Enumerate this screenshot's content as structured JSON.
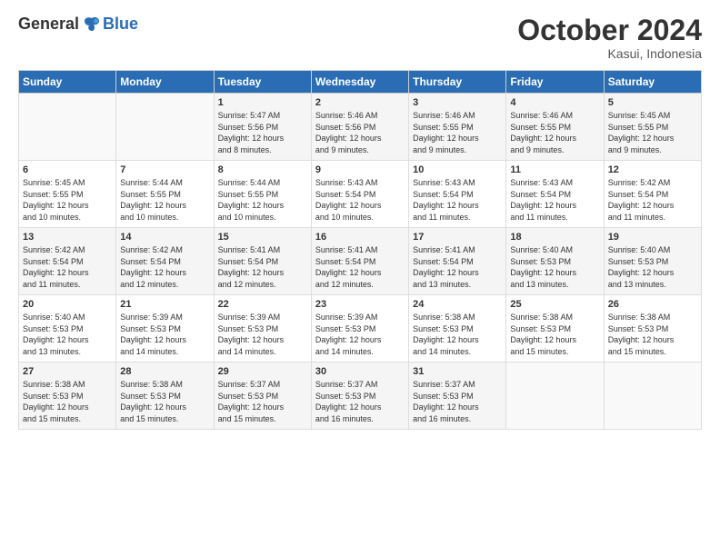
{
  "logo": {
    "general": "General",
    "blue": "Blue"
  },
  "title": "October 2024",
  "location": "Kasui, Indonesia",
  "days_header": [
    "Sunday",
    "Monday",
    "Tuesday",
    "Wednesday",
    "Thursday",
    "Friday",
    "Saturday"
  ],
  "weeks": [
    [
      {
        "day": "",
        "info": ""
      },
      {
        "day": "",
        "info": ""
      },
      {
        "day": "1",
        "info": "Sunrise: 5:47 AM\nSunset: 5:56 PM\nDaylight: 12 hours\nand 8 minutes."
      },
      {
        "day": "2",
        "info": "Sunrise: 5:46 AM\nSunset: 5:56 PM\nDaylight: 12 hours\nand 9 minutes."
      },
      {
        "day": "3",
        "info": "Sunrise: 5:46 AM\nSunset: 5:55 PM\nDaylight: 12 hours\nand 9 minutes."
      },
      {
        "day": "4",
        "info": "Sunrise: 5:46 AM\nSunset: 5:55 PM\nDaylight: 12 hours\nand 9 minutes."
      },
      {
        "day": "5",
        "info": "Sunrise: 5:45 AM\nSunset: 5:55 PM\nDaylight: 12 hours\nand 9 minutes."
      }
    ],
    [
      {
        "day": "6",
        "info": "Sunrise: 5:45 AM\nSunset: 5:55 PM\nDaylight: 12 hours\nand 10 minutes."
      },
      {
        "day": "7",
        "info": "Sunrise: 5:44 AM\nSunset: 5:55 PM\nDaylight: 12 hours\nand 10 minutes."
      },
      {
        "day": "8",
        "info": "Sunrise: 5:44 AM\nSunset: 5:55 PM\nDaylight: 12 hours\nand 10 minutes."
      },
      {
        "day": "9",
        "info": "Sunrise: 5:43 AM\nSunset: 5:54 PM\nDaylight: 12 hours\nand 10 minutes."
      },
      {
        "day": "10",
        "info": "Sunrise: 5:43 AM\nSunset: 5:54 PM\nDaylight: 12 hours\nand 11 minutes."
      },
      {
        "day": "11",
        "info": "Sunrise: 5:43 AM\nSunset: 5:54 PM\nDaylight: 12 hours\nand 11 minutes."
      },
      {
        "day": "12",
        "info": "Sunrise: 5:42 AM\nSunset: 5:54 PM\nDaylight: 12 hours\nand 11 minutes."
      }
    ],
    [
      {
        "day": "13",
        "info": "Sunrise: 5:42 AM\nSunset: 5:54 PM\nDaylight: 12 hours\nand 11 minutes."
      },
      {
        "day": "14",
        "info": "Sunrise: 5:42 AM\nSunset: 5:54 PM\nDaylight: 12 hours\nand 12 minutes."
      },
      {
        "day": "15",
        "info": "Sunrise: 5:41 AM\nSunset: 5:54 PM\nDaylight: 12 hours\nand 12 minutes."
      },
      {
        "day": "16",
        "info": "Sunrise: 5:41 AM\nSunset: 5:54 PM\nDaylight: 12 hours\nand 12 minutes."
      },
      {
        "day": "17",
        "info": "Sunrise: 5:41 AM\nSunset: 5:54 PM\nDaylight: 12 hours\nand 13 minutes."
      },
      {
        "day": "18",
        "info": "Sunrise: 5:40 AM\nSunset: 5:53 PM\nDaylight: 12 hours\nand 13 minutes."
      },
      {
        "day": "19",
        "info": "Sunrise: 5:40 AM\nSunset: 5:53 PM\nDaylight: 12 hours\nand 13 minutes."
      }
    ],
    [
      {
        "day": "20",
        "info": "Sunrise: 5:40 AM\nSunset: 5:53 PM\nDaylight: 12 hours\nand 13 minutes."
      },
      {
        "day": "21",
        "info": "Sunrise: 5:39 AM\nSunset: 5:53 PM\nDaylight: 12 hours\nand 14 minutes."
      },
      {
        "day": "22",
        "info": "Sunrise: 5:39 AM\nSunset: 5:53 PM\nDaylight: 12 hours\nand 14 minutes."
      },
      {
        "day": "23",
        "info": "Sunrise: 5:39 AM\nSunset: 5:53 PM\nDaylight: 12 hours\nand 14 minutes."
      },
      {
        "day": "24",
        "info": "Sunrise: 5:38 AM\nSunset: 5:53 PM\nDaylight: 12 hours\nand 14 minutes."
      },
      {
        "day": "25",
        "info": "Sunrise: 5:38 AM\nSunset: 5:53 PM\nDaylight: 12 hours\nand 15 minutes."
      },
      {
        "day": "26",
        "info": "Sunrise: 5:38 AM\nSunset: 5:53 PM\nDaylight: 12 hours\nand 15 minutes."
      }
    ],
    [
      {
        "day": "27",
        "info": "Sunrise: 5:38 AM\nSunset: 5:53 PM\nDaylight: 12 hours\nand 15 minutes."
      },
      {
        "day": "28",
        "info": "Sunrise: 5:38 AM\nSunset: 5:53 PM\nDaylight: 12 hours\nand 15 minutes."
      },
      {
        "day": "29",
        "info": "Sunrise: 5:37 AM\nSunset: 5:53 PM\nDaylight: 12 hours\nand 15 minutes."
      },
      {
        "day": "30",
        "info": "Sunrise: 5:37 AM\nSunset: 5:53 PM\nDaylight: 12 hours\nand 16 minutes."
      },
      {
        "day": "31",
        "info": "Sunrise: 5:37 AM\nSunset: 5:53 PM\nDaylight: 12 hours\nand 16 minutes."
      },
      {
        "day": "",
        "info": ""
      },
      {
        "day": "",
        "info": ""
      }
    ]
  ]
}
